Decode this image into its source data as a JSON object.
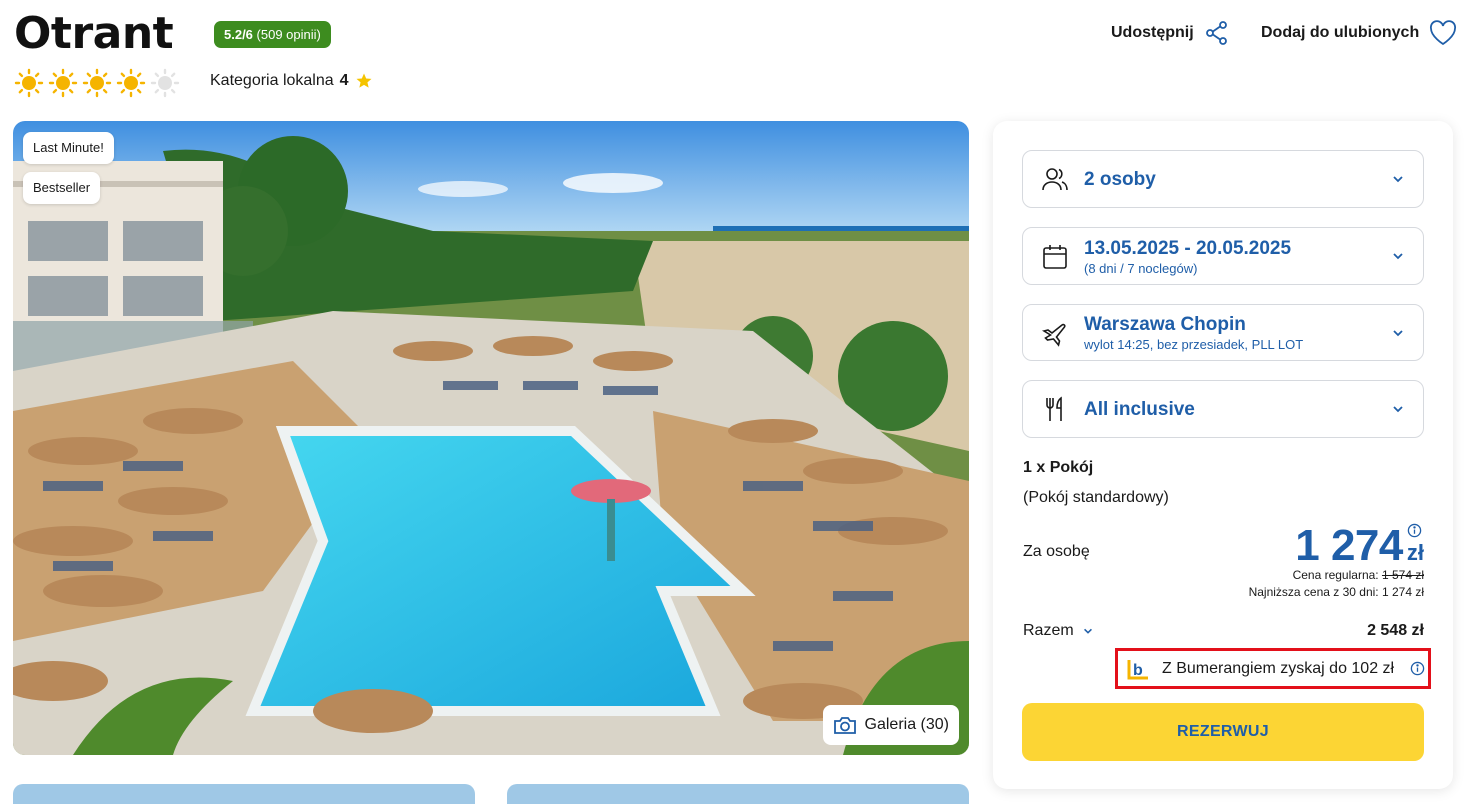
{
  "header": {
    "title": "Otrant",
    "rating_score": "5.2/6",
    "rating_count": "(509 opinii)",
    "suns_filled": 4,
    "suns_total": 5,
    "category_label": "Kategoria lokalna",
    "category_value": "4",
    "share_label": "Udostępnij",
    "favorite_label": "Dodaj do ulubionych"
  },
  "gallery": {
    "badges": [
      "Last Minute!",
      "Bestseller"
    ],
    "gallery_label": "Galeria (30)"
  },
  "booking": {
    "persons": "2 osoby",
    "dates": "13.05.2025 - 20.05.2025",
    "dates_sub": "(8 dni / 7 noclegów)",
    "airport": "Warszawa Chopin",
    "flight_sub": "wylot 14:25, bez przesiadek, PLL LOT",
    "board": "All inclusive",
    "room_count": "1 x Pokój",
    "room_type": "(Pokój standardowy)",
    "per_person_label": "Za osobę",
    "price": "1 274",
    "currency": "zł",
    "regular_label": "Cena regularna:",
    "regular_price": "1 574 zł",
    "lowest_label": "Najniższa cena z 30 dni: 1 274 zł",
    "total_label": "Razem",
    "total_value": "2 548 zł",
    "boomerang_text": "Z Bumerangiem zyskaj do 102 zł",
    "book_label": "REZERWUJ"
  },
  "colors": {
    "accent": "#1f5ea8",
    "rating_bg": "#3d8c1f",
    "book_button": "#fcd534",
    "highlight_border": "#e3101a",
    "sun": "#f5b400"
  },
  "icons": [
    "sun-icon",
    "star-icon",
    "share-icon",
    "heart-icon",
    "people-icon",
    "calendar-icon",
    "plane-icon",
    "cutlery-icon",
    "chevron-down-icon",
    "info-icon",
    "camera-icon",
    "boomerang-logo-icon"
  ]
}
